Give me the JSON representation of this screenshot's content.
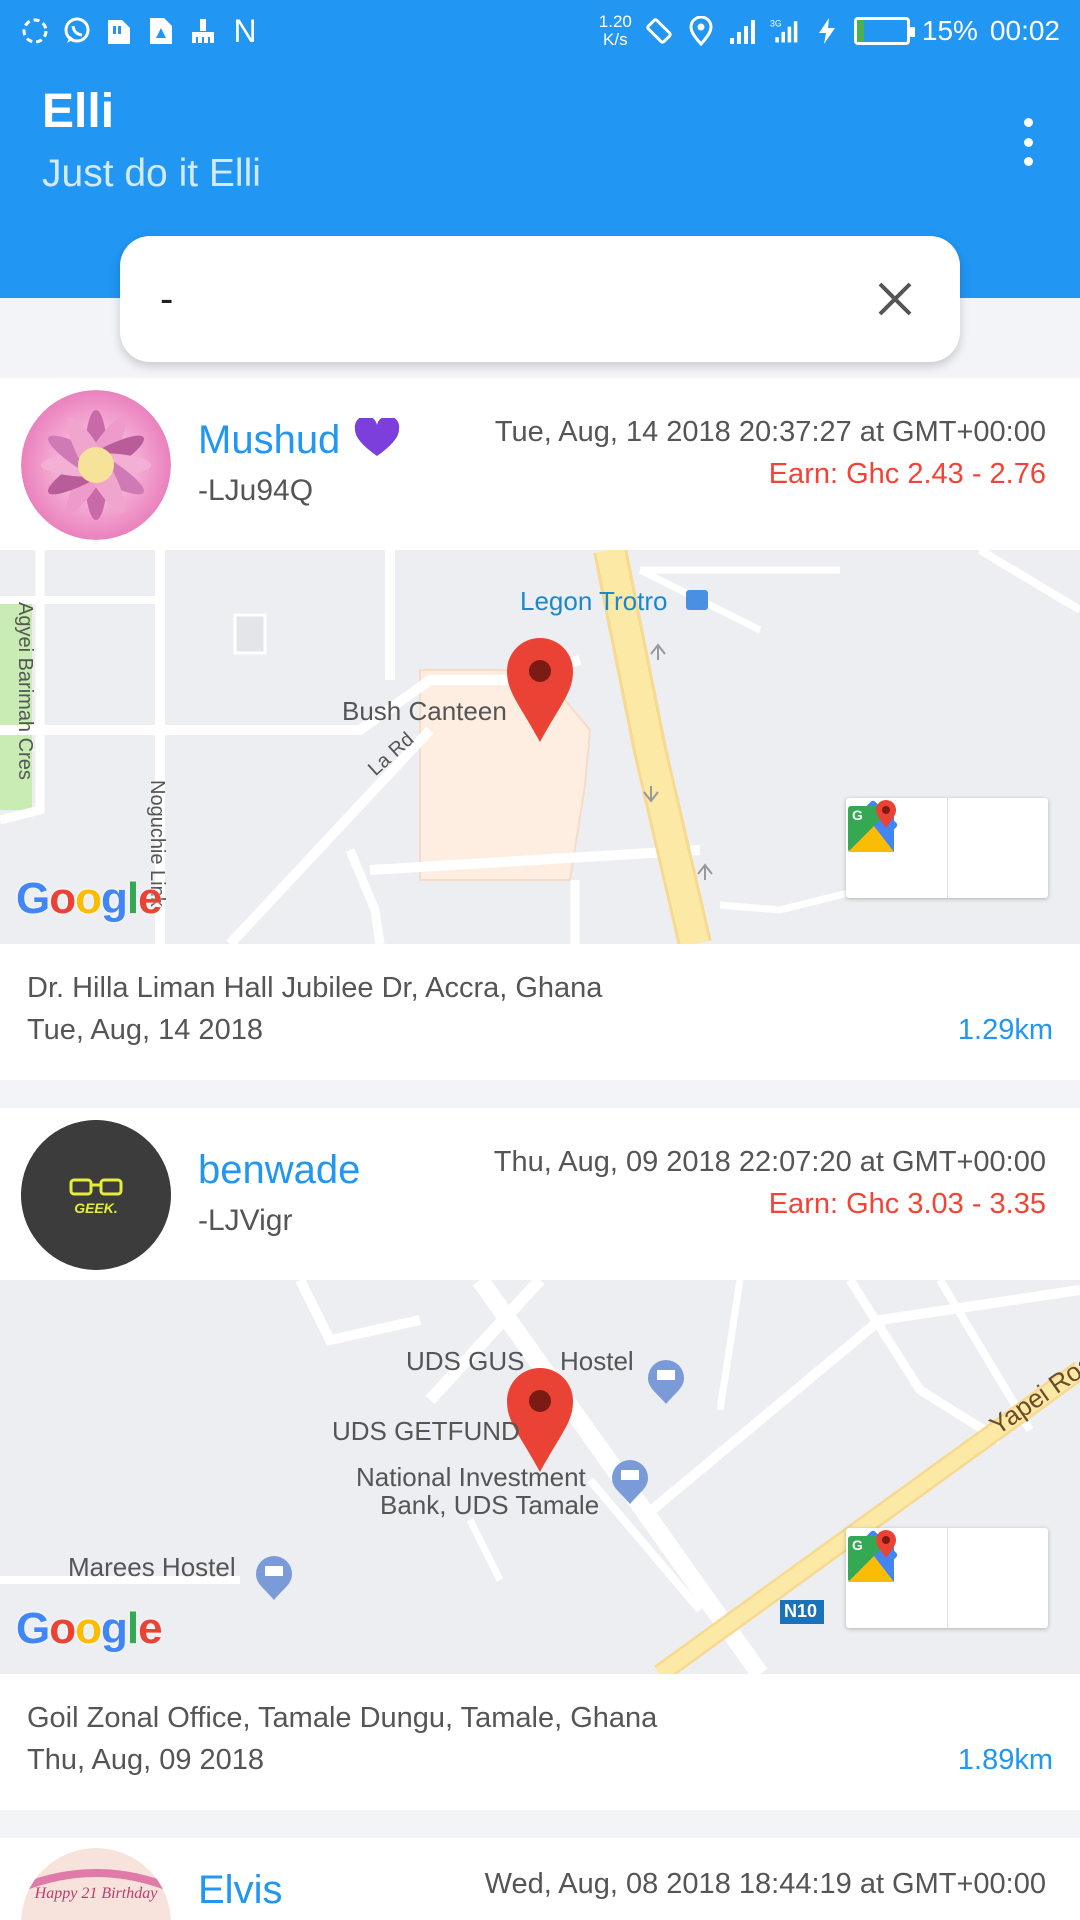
{
  "status_bar": {
    "net_speed_value": "1.20",
    "net_speed_unit": "K/s",
    "battery": "15%",
    "battery_level": 0.15,
    "time": "00:02",
    "icons": [
      "sync-icon",
      "whatsapp-icon",
      "sim-icon",
      "file-icon",
      "cleaner-icon",
      "nfc-icon",
      "rotate-icon",
      "location-icon",
      "signal-icon",
      "3g-signal-icon",
      "charging-icon",
      "battery-icon"
    ]
  },
  "app_bar": {
    "title": "Elli",
    "subtitle": "Just do it Elli",
    "menu_icon": "more-vert-icon"
  },
  "search": {
    "value": "-",
    "clear_icon": "close-icon"
  },
  "cards": [
    {
      "name": "Mushud",
      "badge_icon": "heart-icon",
      "badge_color": "#7c3fdc",
      "uid": "-LJu94Q",
      "timestamp": "Tue, Aug, 14 2018 20:37:27 at GMT+00:00",
      "earn": "Earn: Ghc 2.43 - 2.76",
      "map": {
        "labels": [
          "Legon Trotro",
          "Bush Canteen",
          "La Rd",
          "Agyei Barimah Cres",
          "Noguchie Link"
        ],
        "logo": "Google"
      },
      "address": "Dr. Hilla Liman Hall Jubilee Dr, Accra, Ghana",
      "date": "Tue, Aug, 14 2018",
      "distance": "1.29km"
    },
    {
      "name": "benwade",
      "uid": "-LJVigr",
      "avatar_text": "GEEK.",
      "timestamp": "Thu, Aug, 09 2018 22:07:20 at GMT+00:00",
      "earn": "Earn: Ghc 3.03 - 3.35",
      "map": {
        "labels": [
          "UDS GUS",
          "Hostel",
          "UDS GETFUND",
          "National Investment",
          "Bank, UDS Tamale",
          "Marees Hostel",
          "Yapei Roa",
          "N10"
        ],
        "logo": "Google"
      },
      "address": "Goil Zonal Office, Tamale Dungu, Tamale, Ghana",
      "date": "Thu, Aug, 09 2018",
      "distance": "1.89km"
    },
    {
      "name": "Elvis",
      "avatar_text": "Happy 21 Birthday",
      "timestamp": "Wed, Aug, 08 2018 18:44:19 at GMT+00:00"
    }
  ],
  "colors": {
    "primary": "#2196f3",
    "earn": "#f44336",
    "pin": "#ea4335"
  }
}
